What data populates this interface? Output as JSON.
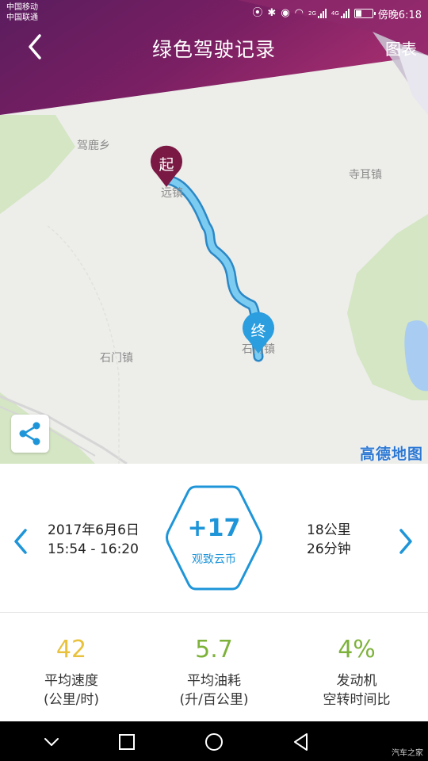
{
  "status_bar": {
    "carrier_1": "中国移动",
    "carrier_2": "中国联通",
    "network_1": "2G",
    "network_2": "4G",
    "time": "傍晚6:18",
    "icons": [
      "location-icon",
      "bluetooth-icon",
      "eye-icon",
      "wifi-icon",
      "signal-icon",
      "battery-icon"
    ],
    "battery_level": 0.35
  },
  "header": {
    "title": "绿色驾驶记录",
    "chart_link": "图表",
    "back_icon": "chevron-left-icon"
  },
  "map": {
    "labels": {
      "jialu": "驾鹿乡",
      "sier": "寺耳镇",
      "shimen": "石门镇",
      "start_town": "远镇",
      "end_town": "石门镇"
    },
    "start_pin": "起",
    "end_pin": "终",
    "provider_logo": "高德地图",
    "share_icon": "share-icon",
    "colors": {
      "route": "#4fb6ea",
      "start_pin": "#7a1a44",
      "end_pin": "#2b9ee0"
    }
  },
  "summary": {
    "date": "2017年6月6日",
    "time_range": "15:54 - 16:20",
    "coins_value": "+17",
    "coins_label": "观致云币",
    "distance": "18公里",
    "duration": "26分钟",
    "accent_color": "#1e95d8"
  },
  "stats": [
    {
      "value": "42",
      "label_line1": "平均速度",
      "label_line2": "(公里/时)",
      "color": "#e8c23c"
    },
    {
      "value": "5.7",
      "label_line1": "平均油耗",
      "label_line2": "(升/百公里)",
      "color": "#7db23a"
    },
    {
      "value": "4%",
      "label_line1": "发动机",
      "label_line2": "空转时间比",
      "color": "#7db23a"
    }
  ],
  "navbar": {
    "icons": [
      "chevron-down-icon",
      "square-icon",
      "circle-icon",
      "triangle-back-icon"
    ]
  },
  "watermark": "汽车之家"
}
